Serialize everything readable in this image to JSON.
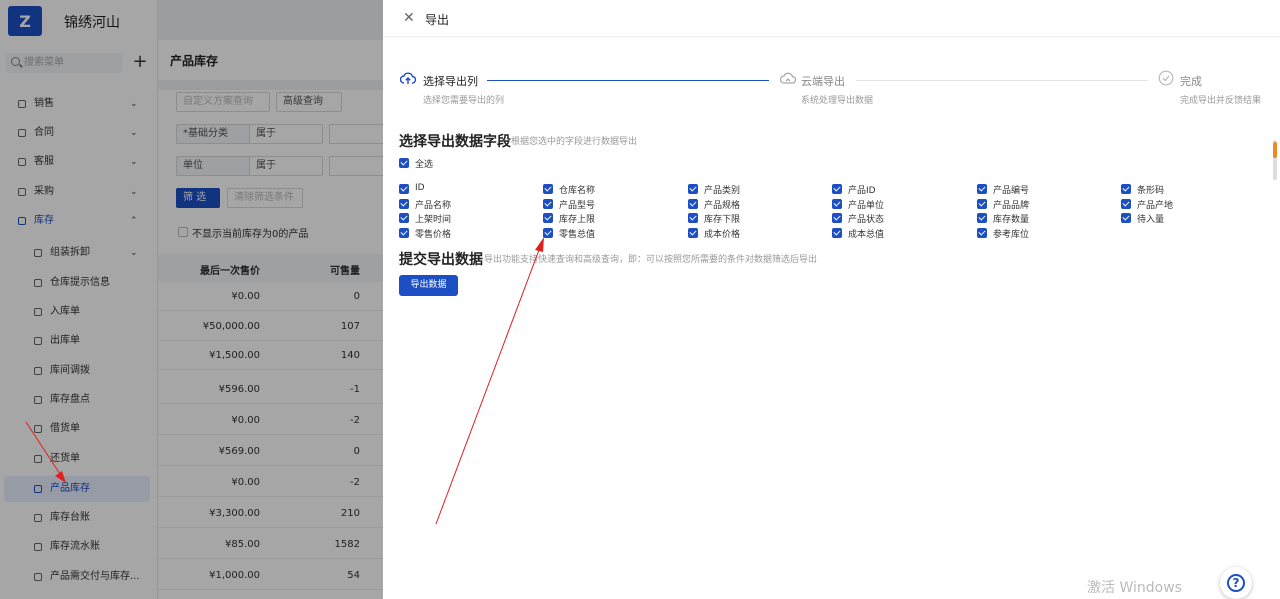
{
  "app": {
    "title": "锦绣河山",
    "logo": "Z"
  },
  "sidebar": {
    "search_placeholder": "搜索菜单",
    "add_label": "+",
    "items": [
      {
        "label": "销售",
        "caret": "⌄"
      },
      {
        "label": "合同",
        "caret": "⌄"
      },
      {
        "label": "客服",
        "caret": "⌄"
      },
      {
        "label": "采购",
        "caret": "⌄"
      },
      {
        "label": "库存",
        "caret": "⌃"
      }
    ],
    "sub_items": [
      {
        "label": "组装拆卸",
        "caret": "⌄"
      },
      {
        "label": "仓库提示信息"
      },
      {
        "label": "入库单"
      },
      {
        "label": "出库单"
      },
      {
        "label": "库间调拨"
      },
      {
        "label": "库存盘点"
      },
      {
        "label": "借货单"
      },
      {
        "label": "还货单"
      },
      {
        "label": "产品库存"
      },
      {
        "label": "库存台账"
      },
      {
        "label": "库存流水账"
      },
      {
        "label": "产品需交付与库存..."
      }
    ]
  },
  "main": {
    "title": "产品库存",
    "custom_query": "自定义方案查询",
    "advanced_query": "高级查询",
    "filter1_label": "*基础分类",
    "filter1_op": "属于",
    "filter2_label": "单位",
    "filter2_op": "属于",
    "filter_button": "筛 选",
    "clear_button": "清除筛选条件",
    "hide_zero": "不显示当前库存为0的产品",
    "columns": [
      "最后一次售价",
      "可售量"
    ],
    "rows": [
      [
        "¥0.00",
        "0"
      ],
      [
        "¥50,000.00",
        "107"
      ],
      [
        "¥1,500.00",
        "140"
      ],
      [
        "¥596.00",
        "-1"
      ],
      [
        "¥0.00",
        "-2"
      ],
      [
        "¥569.00",
        "0"
      ],
      [
        "¥0.00",
        "-2"
      ],
      [
        "¥3,300.00",
        "210"
      ],
      [
        "¥85.00",
        "1582"
      ],
      [
        "¥1,000.00",
        "54"
      ]
    ]
  },
  "drawer": {
    "title": "导出",
    "close": "✕",
    "steps": [
      {
        "title": "选择导出列",
        "desc": "选择您需要导出的列"
      },
      {
        "title": "云端导出",
        "desc": "系统处理导出数据"
      },
      {
        "title": "完成",
        "desc": "完成导出并反馈结果"
      }
    ],
    "section1_title": "选择导出数据字段",
    "section1_hint": "根据您选中的字段进行数据导出",
    "select_all": "全选",
    "fields": [
      [
        "ID",
        "仓库名称",
        "产品类别",
        "产品ID",
        "产品编号",
        "条形码"
      ],
      [
        "产品名称",
        "产品型号",
        "产品规格",
        "产品单位",
        "产品品牌",
        "产品产地"
      ],
      [
        "上架时间",
        "库存上限",
        "库存下限",
        "产品状态",
        "库存数量",
        "待入量"
      ],
      [
        "零售价格",
        "零售总值",
        "成本价格",
        "成本总值",
        "参考库位"
      ]
    ],
    "section2_title": "提交导出数据",
    "section2_hint": "导出功能支持快速查询和高级查询，即：可以按照您所需要的条件对数据筛选后导出",
    "export_button": "导出数据"
  },
  "watermark": "激活 Windows",
  "help": "?",
  "colors": {
    "primary": "#1d4fc4",
    "annotation": "#e02020"
  }
}
